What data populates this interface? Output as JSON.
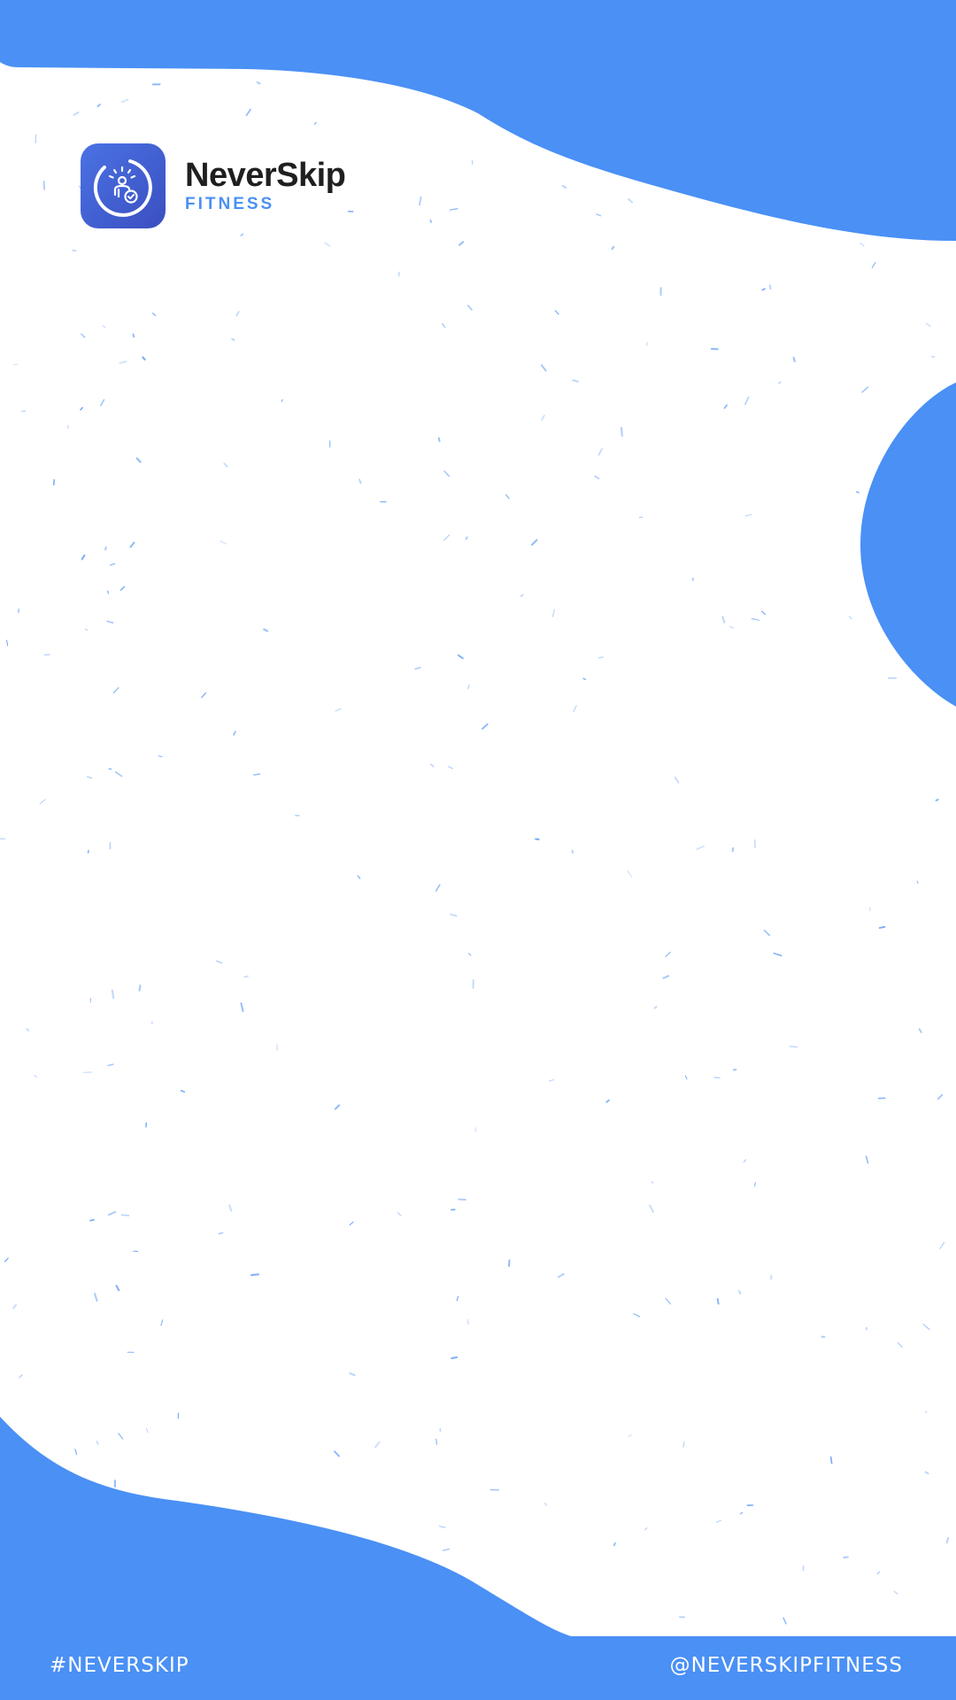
{
  "brand": {
    "name": "NeverSkip",
    "subtitle": "FITNESS",
    "icon": "fitness-person-check-icon"
  },
  "footer": {
    "hashtag": "#NEVERSKIP",
    "handle": "@NEVERSKIPFITNESS"
  },
  "colors": {
    "accent_blue": "#4a90f5",
    "icon_gradient_start": "#4a72e4",
    "icon_gradient_end": "#3b4fc0",
    "brand_text": "#1f1f1f",
    "background": "#ffffff"
  }
}
